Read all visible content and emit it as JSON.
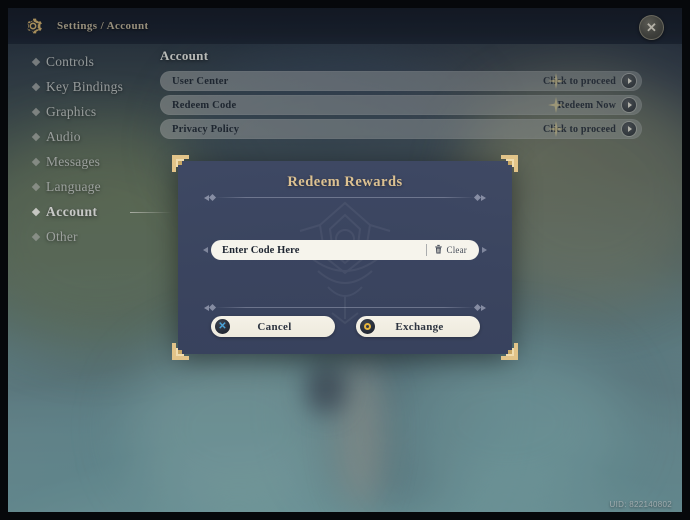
{
  "header": {
    "gear_icon": "gear-icon",
    "breadcrumb": "Settings / Account",
    "close_icon": "close-icon"
  },
  "sidebar": {
    "items": [
      {
        "label": "Controls",
        "selected": false
      },
      {
        "label": "Key Bindings",
        "selected": false
      },
      {
        "label": "Graphics",
        "selected": false
      },
      {
        "label": "Audio",
        "selected": false
      },
      {
        "label": "Messages",
        "selected": false
      },
      {
        "label": "Language",
        "selected": false
      },
      {
        "label": "Account",
        "selected": true
      },
      {
        "label": "Other",
        "selected": false
      }
    ]
  },
  "content": {
    "title": "Account",
    "rows": [
      {
        "label": "User Center",
        "action": "Click to proceed"
      },
      {
        "label": "Redeem Code",
        "action": "Redeem Now"
      },
      {
        "label": "Privacy Policy",
        "action": "Click to proceed"
      }
    ]
  },
  "dialog": {
    "title": "Redeem Rewards",
    "input": {
      "value": "Enter Code Here",
      "placeholder": "Enter Code Here"
    },
    "clear_label": "Clear",
    "clear_icon": "trash-icon",
    "cancel_label": "Cancel",
    "cancel_icon": "close-circle-icon",
    "exchange_label": "Exchange",
    "exchange_icon": "confirm-circle-icon"
  },
  "footer": {
    "uid": "UID: 822140802"
  },
  "colors": {
    "gold": "#dcc191",
    "dialog_bg": "#3e4864",
    "button_cream": "#f5f2e8",
    "accent_blue": "#4aa3d8",
    "accent_yellow": "#e8b63c"
  }
}
